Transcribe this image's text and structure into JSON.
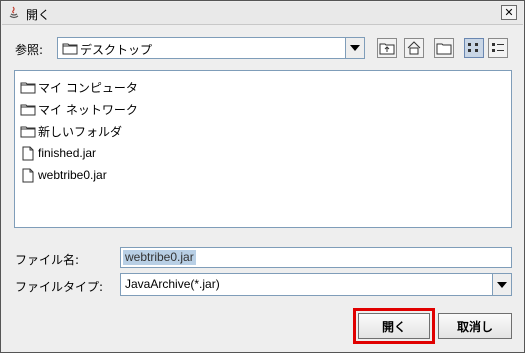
{
  "window": {
    "title": "開く",
    "icon": "java-icon"
  },
  "lookin": {
    "label": "参照:",
    "value": "デスクトップ",
    "icon": "folder-icon"
  },
  "toolbar": {
    "buttons": [
      "up-one-level-icon",
      "home-icon",
      "new-folder-icon",
      "list-view-icon",
      "details-view-icon"
    ]
  },
  "files": [
    {
      "name": "マイ コンピュータ",
      "type": "folder"
    },
    {
      "name": "マイ ネットワーク",
      "type": "folder"
    },
    {
      "name": "新しいフォルダ",
      "type": "folder"
    },
    {
      "name": "finished.jar",
      "type": "file"
    },
    {
      "name": "webtribe0.jar",
      "type": "file"
    }
  ],
  "filename": {
    "label": "ファイル名:",
    "value": "webtribe0.jar"
  },
  "filetype": {
    "label": "ファイルタイプ:",
    "value": "JavaArchive(*.jar)"
  },
  "buttons": {
    "open": "開く",
    "cancel": "取消し"
  },
  "colors": {
    "highlight": "#e00000",
    "selection": "#b8cfe5",
    "border": "#7f9db9"
  }
}
